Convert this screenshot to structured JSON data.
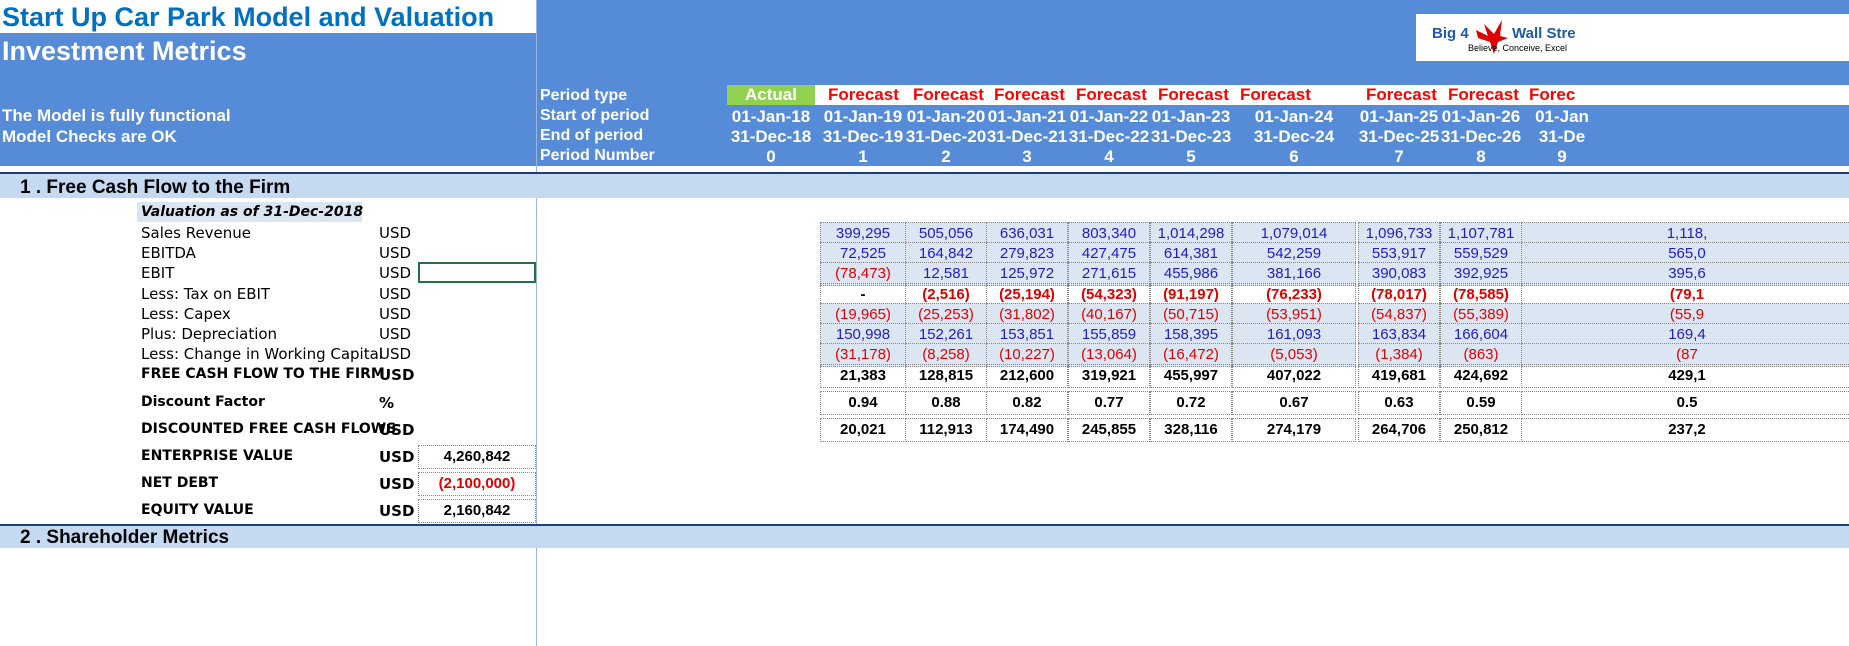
{
  "header": {
    "title": "Start Up Car Park Model and Valuation",
    "subtitle": "Investment Metrics",
    "status_line_1": "The Model is fully functional",
    "status_line_2": "Model Checks are OK",
    "logo_text_1": "Big 4",
    "logo_text_2": "Wall Stre",
    "logo_tagline": "Believe, Conceive, Excel"
  },
  "timeline": {
    "row_labels": [
      "Period type",
      "Start of period",
      "End of period",
      "Period Number"
    ],
    "periods": [
      {
        "type": "Actual",
        "start": "01-Jan-18",
        "end": "31-Dec-18",
        "num": "0"
      },
      {
        "type": "Forecast",
        "start": "01-Jan-19",
        "end": "31-Dec-19",
        "num": "1"
      },
      {
        "type": "Forecast",
        "start": "01-Jan-20",
        "end": "31-Dec-20",
        "num": "2"
      },
      {
        "type": "Forecast",
        "start": "01-Jan-21",
        "end": "31-Dec-21",
        "num": "3"
      },
      {
        "type": "Forecast",
        "start": "01-Jan-22",
        "end": "31-Dec-22",
        "num": "4"
      },
      {
        "type": "Forecast",
        "start": "01-Jan-23",
        "end": "31-Dec-23",
        "num": "5"
      },
      {
        "type": "Forecast",
        "start": "01-Jan-24",
        "end": "31-Dec-24",
        "num": "6"
      },
      {
        "type": "Forecast",
        "start": "01-Jan-25",
        "end": "31-Dec-25",
        "num": "7"
      },
      {
        "type": "Forecast",
        "start": "01-Jan-26",
        "end": "31-Dec-26",
        "num": "8"
      },
      {
        "type": "Forec",
        "start": "01-Jan",
        "end": "31-De",
        "num": "9"
      }
    ]
  },
  "sections": {
    "s1": "1 . Free Cash Flow to the Firm",
    "s2": "2 . Shareholder Metrics"
  },
  "valuation_header": "Valuation as of 31-Dec-2018",
  "rows": [
    {
      "label": "Sales Revenue",
      "unit": "USD",
      "style": "blue",
      "values": [
        "399,295",
        "505,056",
        "636,031",
        "803,340",
        "1,014,298",
        "1,079,014",
        "1,096,733",
        "1,107,781",
        "1,118,"
      ]
    },
    {
      "label": "EBITDA",
      "unit": "USD",
      "style": "blue",
      "values": [
        "72,525",
        "164,842",
        "279,823",
        "427,475",
        "614,381",
        "542,259",
        "553,917",
        "559,529",
        "565,0"
      ]
    },
    {
      "label": "EBIT",
      "unit": "USD",
      "style": "mixed",
      "values": [
        "(78,473)",
        "12,581",
        "125,972",
        "271,615",
        "455,986",
        "381,166",
        "390,083",
        "392,925",
        "395,6"
      ]
    },
    {
      "label": "Less: Tax on EBIT",
      "unit": "USD",
      "style": "redbold",
      "values": [
        "-",
        "(2,516)",
        "(25,194)",
        "(54,323)",
        "(91,197)",
        "(76,233)",
        "(78,017)",
        "(78,585)",
        "(79,1"
      ]
    },
    {
      "label": "Less: Capex",
      "unit": "USD",
      "style": "red",
      "values": [
        "(19,965)",
        "(25,253)",
        "(31,802)",
        "(40,167)",
        "(50,715)",
        "(53,951)",
        "(54,837)",
        "(55,389)",
        "(55,9"
      ]
    },
    {
      "label": "Plus: Depreciation",
      "unit": "USD",
      "style": "blue",
      "values": [
        "150,998",
        "152,261",
        "153,851",
        "155,859",
        "158,395",
        "161,093",
        "163,834",
        "166,604",
        "169,4"
      ]
    },
    {
      "label": "Less: Change in Working Capital",
      "unit": "USD",
      "style": "red",
      "values": [
        "(31,178)",
        "(8,258)",
        "(10,227)",
        "(13,064)",
        "(16,472)",
        "(5,053)",
        "(1,384)",
        "(863)",
        "(87"
      ]
    },
    {
      "label": "FREE CASH FLOW TO THE FIRM",
      "unit": "USD",
      "style": "bold",
      "values": [
        "21,383",
        "128,815",
        "212,600",
        "319,921",
        "455,997",
        "407,022",
        "419,681",
        "424,692",
        "429,1"
      ]
    }
  ],
  "discount": {
    "label": "Discount Factor",
    "unit": "%",
    "values": [
      "0.94",
      "0.88",
      "0.82",
      "0.77",
      "0.72",
      "0.67",
      "0.63",
      "0.59",
      "0.5"
    ]
  },
  "dfcf": {
    "label": "DISCOUNTED FREE CASH FLOWS",
    "unit": "USD",
    "values": [
      "20,021",
      "112,913",
      "174,490",
      "245,855",
      "328,116",
      "274,179",
      "264,706",
      "250,812",
      "237,2"
    ]
  },
  "summary": [
    {
      "label": "ENTERPRISE VALUE",
      "unit": "USD",
      "value": "4,260,842",
      "red": false
    },
    {
      "label": "NET DEBT",
      "unit": "USD",
      "value": "(2,100,000)",
      "red": true
    },
    {
      "label": "EQUITY VALUE",
      "unit": "USD",
      "value": "2,160,842",
      "red": false
    }
  ],
  "colors": {
    "band": "#568CD7",
    "actual": "#92D050",
    "forecast_text": "#FF0000",
    "title": "#0070C0",
    "section": "#C5D9F1"
  }
}
